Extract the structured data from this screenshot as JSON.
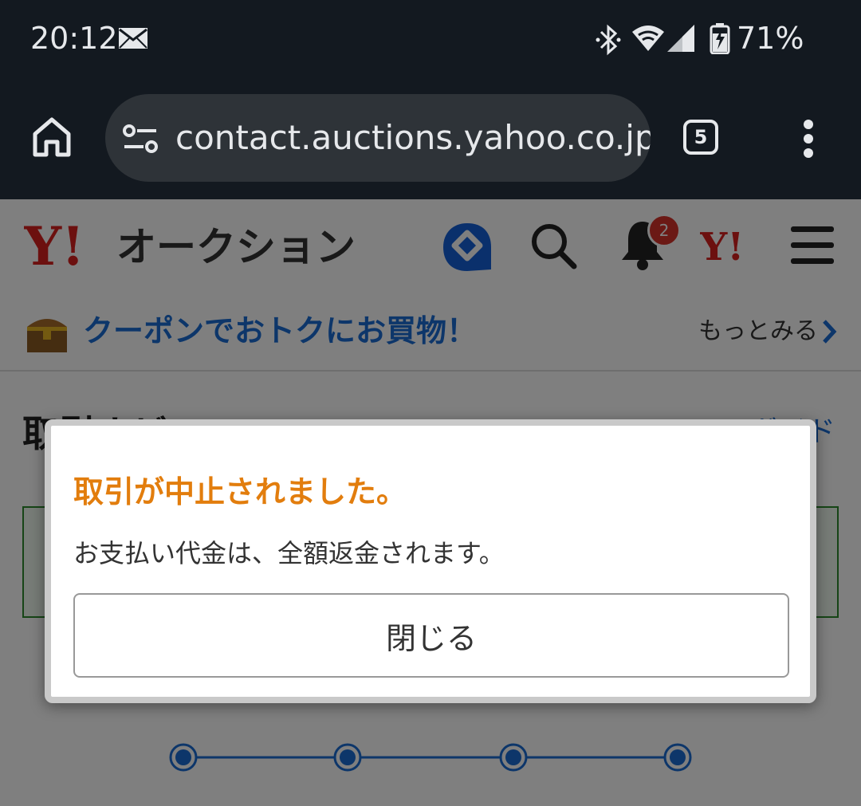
{
  "status_bar": {
    "time": "20:12",
    "battery": "71%"
  },
  "browser": {
    "url": "contact.auctions.yahoo.co.jp",
    "tab_count": "5"
  },
  "site_header": {
    "logo_text": "オークション",
    "notification_count": "2"
  },
  "coupon_banner": {
    "text": "クーポンでおトクにお買物！",
    "more_label": "もっとみる"
  },
  "behind": {
    "title": "取引ナビ",
    "guide_link": "ガイド"
  },
  "dialog": {
    "title": "取引が中止されました。",
    "message": "お支払い代金は、全額返金されます。",
    "close_label": "閉じる"
  },
  "colors": {
    "dialog_title": "#e27d0d",
    "link_blue": "#1a6dd4",
    "badge_red": "#d6332b",
    "yahoo_red": "#d9201f"
  }
}
